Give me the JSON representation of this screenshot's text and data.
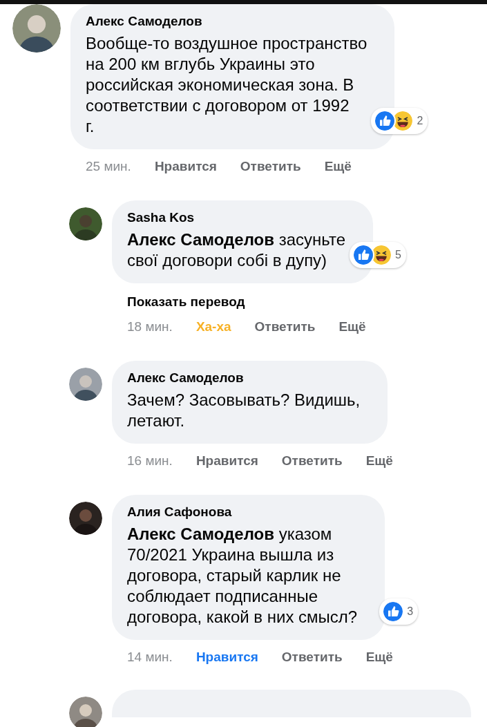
{
  "comment": {
    "author": "Алекс Самоделов",
    "text": "Вообще-то воздушное пространство\nна 200 км вглубь Украины это\nроссийская экономическая зона. В\nсоответствии с договором от 1992\nг.",
    "reactions": {
      "icons": [
        {
          "kind": "like"
        },
        {
          "kind": "haha"
        }
      ],
      "count": "2"
    },
    "time": "25 мин.",
    "actions": [
      {
        "label": "Нравится",
        "color": "#65676b"
      },
      {
        "label": "Ответить",
        "color": "#65676b"
      },
      {
        "label": "Ещё",
        "color": "#65676b"
      }
    ],
    "children": [
      {
        "kind": "comment",
        "author": "Sasha Kos",
        "text": "**Алекс Самоделов** засуньте\nсвої договори собі в дупу)",
        "reactions": {
          "icons": [
            {
              "kind": "like"
            },
            {
              "kind": "haha"
            }
          ],
          "count": "5"
        },
        "translate": "Показать перевод",
        "time": "18 мин.",
        "actions": [
          {
            "label": "Ха-ха",
            "color": "#f7b125"
          },
          {
            "label": "Ответить",
            "color": "#65676b"
          },
          {
            "label": "Ещё",
            "color": "#65676b"
          }
        ]
      },
      {
        "kind": "comment",
        "author": "Алекс Самоделов",
        "text": "Зачем? Засовывать? Видишь,\nлетают.",
        "time": "16 мин.",
        "actions": [
          {
            "label": "Нравится",
            "color": "#65676b"
          },
          {
            "label": "Ответить",
            "color": "#65676b"
          },
          {
            "label": "Ещё",
            "color": "#65676b"
          }
        ]
      },
      {
        "kind": "comment",
        "author": "Алия Сафонова",
        "text": "**Алекс Самоделов** указом\n70/2021 Украина вышла из\nдоговора, старый карлик не\nсоблюдает подписанные\nдоговора, какой в них смысл?",
        "reactions": {
          "icons": [
            {
              "kind": "like"
            }
          ],
          "count": "3"
        },
        "time": "14 мин.",
        "actions": [
          {
            "label": "Нравится",
            "color": "#1877f2"
          },
          {
            "label": "Ответить",
            "color": "#65676b"
          },
          {
            "label": "Ещё",
            "color": "#65676b"
          }
        ]
      },
      {
        "kind": "cut_off"
      }
    ]
  }
}
